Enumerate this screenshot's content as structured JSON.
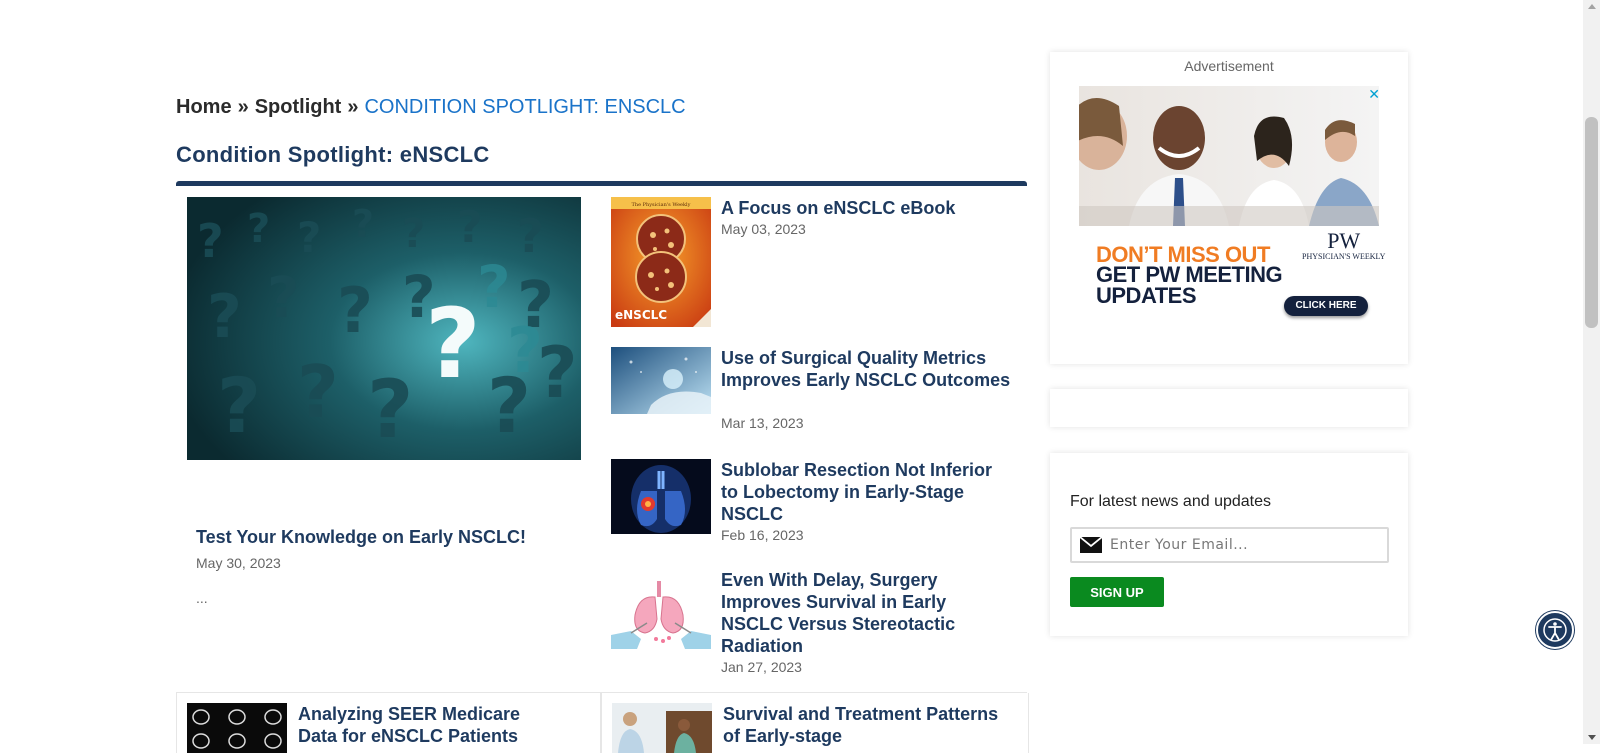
{
  "breadcrumb": {
    "home": "Home",
    "separator": "»",
    "spotlight": "Spotlight",
    "current": "CONDITION SPOTLIGHT: ENSCLC"
  },
  "page_title": "Condition Spotlight: eNSCLC",
  "featured": {
    "title": "Test Your Knowledge on Early NSCLC!",
    "date": "May 30, 2023",
    "excerpt": "..."
  },
  "articles": [
    {
      "title": "A Focus on eNSCLC eBook",
      "date": "May 03, 2023",
      "thumb_text_top": "The Physician's Weekly",
      "thumb_text_bottom": "eNSCLC"
    },
    {
      "title": "Use of Surgical Quality Metrics Improves Early NSCLC Outcomes",
      "date": "Mar 13, 2023"
    },
    {
      "title": "Sublobar Resection Not Inferior to Lobectomy in Early-Stage NSCLC",
      "date": "Feb 16, 2023"
    },
    {
      "title": "Even With Delay, Surgery Improves Survival in Early NSCLC Versus Stereotactic Radiation",
      "date": "Jan 27, 2023"
    }
  ],
  "bottom_articles": [
    {
      "title": "Analyzing SEER Medicare Data for eNSCLC Patients"
    },
    {
      "title": "Survival and Treatment Patterns of Early-stage"
    }
  ],
  "ad": {
    "label": "Advertisement",
    "close": "✕",
    "headline1": "DON’T MISS OUT",
    "headline2": "GET PW MEETING UPDATES",
    "logo": "PW",
    "logo_sub": "PHYSICIAN'S WEEKLY",
    "cta": "CLICK HERE"
  },
  "newsletter": {
    "text": "For latest news and updates",
    "email_placeholder": "Enter Your Email...",
    "signup_label": "SIGN UP"
  },
  "colors": {
    "brand_navy": "#1e3a5f",
    "breadcrumb_current": "#1a73c9",
    "signup_green": "#0a8a1f",
    "ad_orange": "#f07c23"
  },
  "icons": {
    "email": "envelope-icon",
    "accessibility": "accessibility-icon",
    "close": "close-icon"
  }
}
